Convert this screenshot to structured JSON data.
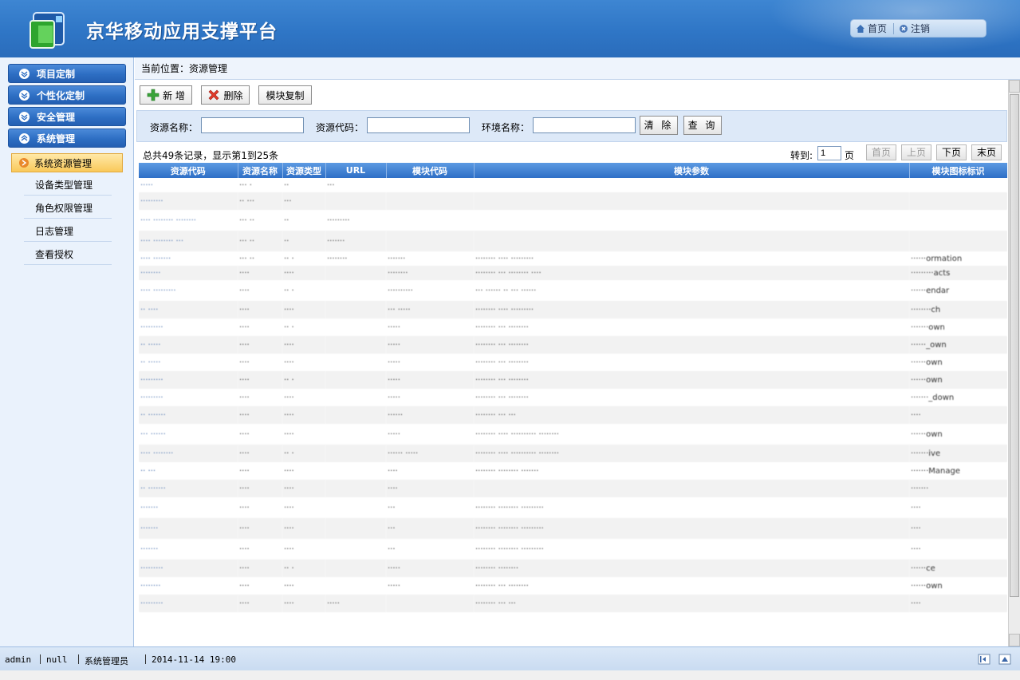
{
  "header": {
    "title": "京华移动应用支撑平台",
    "links": [
      {
        "label": "首页",
        "icon": "home-icon"
      },
      {
        "label": "注销",
        "icon": "logout-icon"
      }
    ]
  },
  "sidebar": {
    "menus": [
      {
        "label": "项目定制"
      },
      {
        "label": "个性化定制"
      },
      {
        "label": "安全管理"
      },
      {
        "label": "系统管理"
      }
    ],
    "active_item": "系统资源管理",
    "sub_items": [
      {
        "label": "设备类型管理"
      },
      {
        "label": "角色权限管理"
      },
      {
        "label": "日志管理"
      },
      {
        "label": "查看授权"
      }
    ]
  },
  "breadcrumb": "当前位置：资源管理",
  "toolbar": {
    "add_label": "新 增",
    "delete_label": "删除",
    "copy_label": "模块复制"
  },
  "filter": {
    "name_label": "资源名称：",
    "code_label": "资源代码：",
    "env_label": "环境名称：",
    "clear_label": "清 除",
    "query_label": "查 询",
    "name_value": "",
    "code_value": "",
    "env_value": ""
  },
  "pager": {
    "summary": "总共49条记录，显示第1到25条",
    "goto_label": "转到:",
    "page_value": "1",
    "page_unit": "页",
    "first": "首页",
    "prev": "上页",
    "next": "下页",
    "last": "末页"
  },
  "table": {
    "columns": [
      "资源代码",
      "资源名称",
      "资源类型",
      "URL",
      "模块代码",
      "模块参数",
      "模块图标标识"
    ],
    "rows": [
      {
        "code": "·····",
        "name": "··· ·",
        "type": "··",
        "url": "···",
        "module": "",
        "param": "",
        "icon": ""
      },
      {
        "code": "·········",
        "name": "·· ···",
        "type": "···",
        "url": "",
        "module": "",
        "param": "",
        "icon": ""
      },
      {
        "code": "···· ········ ········",
        "name": "··· ··",
        "type": "··",
        "url": "·········",
        "module": "",
        "param": "",
        "icon": ""
      },
      {
        "code": "···· ········ ···",
        "name": "··· ··",
        "type": "··",
        "url": "·······",
        "module": "",
        "param": "",
        "icon": ""
      },
      {
        "code": "···· ·······",
        "name": "··· ··",
        "type": "·· ·",
        "url": "········",
        "module": "·······",
        "param": "········ ···· ·········",
        "icon": "······ormation"
      },
      {
        "code": "········",
        "name": "····",
        "type": "····",
        "url": "",
        "module": "········",
        "param": "········ ··· ········ ····",
        "icon": "·········acts"
      },
      {
        "code": "···· ·········",
        "name": "····",
        "type": "·· ·",
        "url": "",
        "module": "··········",
        "param": "··· ······ ·· ··· ······",
        "icon": "······endar"
      },
      {
        "code": "·· ····",
        "name": "····",
        "type": "····",
        "url": "",
        "module": "··· ·····",
        "param": "········ ···· ·········",
        "icon": "········ch"
      },
      {
        "code": "·········",
        "name": "····",
        "type": "·· ·",
        "url": "",
        "module": "·····",
        "param": "········ ··· ········",
        "icon": "·······own"
      },
      {
        "code": "·· ·····",
        "name": "····",
        "type": "····",
        "url": "",
        "module": "·····",
        "param": "········ ··· ········",
        "icon": "······_own"
      },
      {
        "code": "·· ·····",
        "name": "····",
        "type": "····",
        "url": "",
        "module": "·····",
        "param": "········ ··· ········",
        "icon": "······own"
      },
      {
        "code": "·········",
        "name": "····",
        "type": "·· ·",
        "url": "",
        "module": "·····",
        "param": "········ ··· ········",
        "icon": "······own"
      },
      {
        "code": "·········",
        "name": "····",
        "type": "····",
        "url": "",
        "module": "·····",
        "param": "········ ··· ········",
        "icon": "·······_down"
      },
      {
        "code": "·· ·······",
        "name": "····",
        "type": "····",
        "url": "",
        "module": "······",
        "param": "········ ··· ···",
        "icon": "····"
      },
      {
        "code": "··· ······",
        "name": "····",
        "type": "····",
        "url": "",
        "module": "·····",
        "param": "········ ···· ·········· ········",
        "icon": "······own"
      },
      {
        "code": "···· ········",
        "name": "····",
        "type": "·· ·",
        "url": "",
        "module": "······ ·····",
        "param": "········ ···· ·········· ········",
        "icon": "·······ive"
      },
      {
        "code": "·· ···",
        "name": "····",
        "type": "····",
        "url": "",
        "module": "····",
        "param": "········ ········ ·······",
        "icon": "·······Manage"
      },
      {
        "code": "·· ·······",
        "name": "····",
        "type": "····",
        "url": "",
        "module": "····",
        "param": "",
        "icon": "·······"
      },
      {
        "code": "·······",
        "name": "····",
        "type": "····",
        "url": "",
        "module": "···",
        "param": "········ ········ ·········",
        "icon": "····"
      },
      {
        "code": "·······",
        "name": "····",
        "type": "····",
        "url": "",
        "module": "···",
        "param": "········ ········ ·········",
        "icon": "····"
      },
      {
        "code": "·······",
        "name": "····",
        "type": "····",
        "url": "",
        "module": "···",
        "param": "········ ········ ·········",
        "icon": "····"
      },
      {
        "code": "·········",
        "name": "····",
        "type": "·· ·",
        "url": "",
        "module": "·····",
        "param": "········ ········",
        "icon": "······ce"
      },
      {
        "code": "········",
        "name": "····",
        "type": "····",
        "url": "",
        "module": "·····",
        "param": "········ ··· ········",
        "icon": "······own"
      },
      {
        "code": "·········",
        "name": "····",
        "type": "····",
        "url": "·····",
        "module": "",
        "param": "········ ··· ···",
        "icon": "····"
      }
    ]
  },
  "status": {
    "user": "admin",
    "value2": "null",
    "role": "系统管理员",
    "datetime": "2014-11-14 19:00"
  }
}
